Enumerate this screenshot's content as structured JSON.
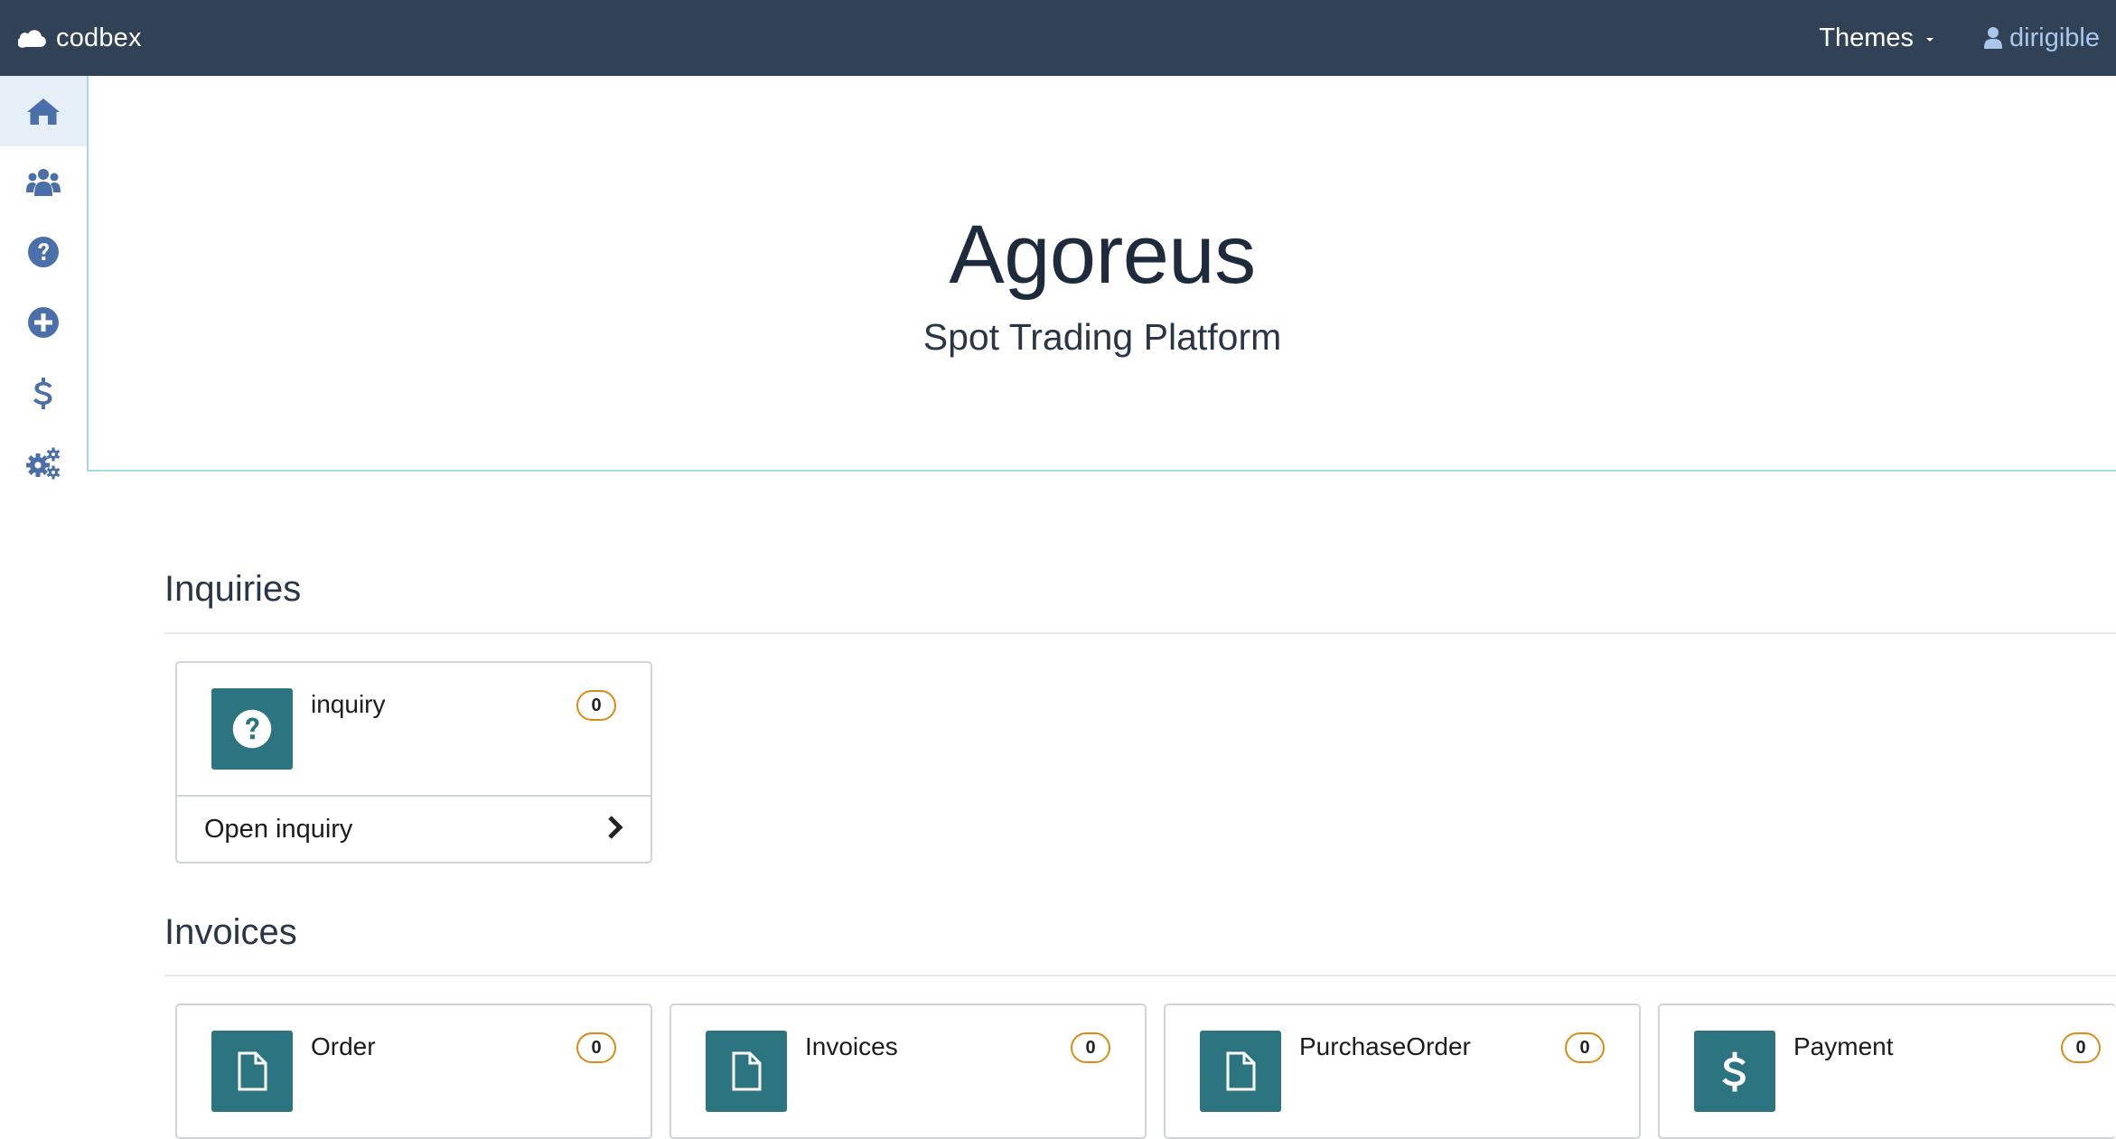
{
  "navbar": {
    "brand": "codbex",
    "brand_icon": "cloud-icon",
    "themes_label": "Themes",
    "user_label": "dirigible",
    "background": "#324256",
    "user_color": "#a9c7ea"
  },
  "sidebar": {
    "items": [
      {
        "name": "home",
        "icon": "home-icon",
        "active": true
      },
      {
        "name": "users",
        "icon": "users-icon"
      },
      {
        "name": "inquiries",
        "icon": "question-circle-icon"
      },
      {
        "name": "add",
        "icon": "plus-circle-icon"
      },
      {
        "name": "payments",
        "icon": "dollar-icon"
      },
      {
        "name": "settings",
        "icon": "cogs-icon"
      }
    ],
    "icon_color": "#4b6fa8"
  },
  "jumbotron": {
    "title": "Agoreus",
    "subtitle": "Spot Trading Platform"
  },
  "sections": {
    "inquiries": {
      "title": "Inquiries",
      "cards": [
        {
          "name": "inquiry",
          "count": "0",
          "icon": "question-circle-icon",
          "footer": "Open inquiry"
        }
      ]
    },
    "invoices": {
      "title": "Invoices",
      "cards": [
        {
          "name": "Order",
          "count": "0",
          "icon": "file-icon"
        },
        {
          "name": "Invoices",
          "count": "0",
          "icon": "file-icon"
        },
        {
          "name": "PurchaseOrder",
          "count": "0",
          "icon": "file-icon"
        },
        {
          "name": "Payment",
          "count": "0",
          "icon": "dollar-icon"
        }
      ]
    }
  },
  "colors": {
    "tile": "#2c7480",
    "badge_border": "#d98a1a",
    "jumbotron_border": "#a8d8e3"
  }
}
